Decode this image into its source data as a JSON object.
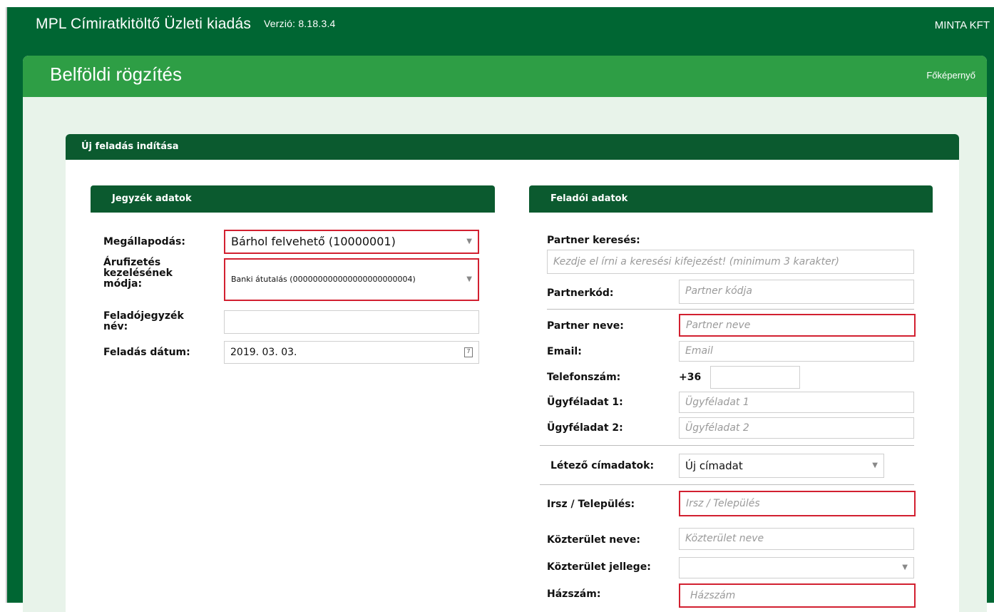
{
  "app": {
    "title": "MPL Címiratkitöltő Üzleti kiadás",
    "version": "Verzió: 8.18.3.4",
    "company": "MINTA KFT"
  },
  "page": {
    "title": "Belföldi rögzítés",
    "home_link": "Főképernyő"
  },
  "card": {
    "title": "Új feladás indítása"
  },
  "left": {
    "section_title": "Jegyzék adatok",
    "agreement_label": "Megállapodás:",
    "agreement_value": "Bárhol felvehető (10000001)",
    "payment_label_1": "Árufizetés",
    "payment_label_2": "kezelésének",
    "payment_label_3": "módja:",
    "payment_value": "Banki átutalás (000000000000000000000004)",
    "sender_list_label_1": "Feladójegyzék",
    "sender_list_label_2": "név:",
    "sender_list_value": "",
    "date_label": "Feladás dátum:",
    "date_value": "2019. 03. 03."
  },
  "right": {
    "section_title": "Feladói adatok",
    "search_label": "Partner keresés:",
    "search_placeholder": "Kezdje el írni a keresési kifejezést! (minimum 3 karakter)",
    "code_label": "Partnerkód:",
    "code_placeholder": "Partner kódja",
    "name_label": "Partner neve:",
    "name_placeholder": "Partner neve",
    "email_label": "Email:",
    "email_placeholder": "Email",
    "phone_label": "Telefonszám:",
    "phone_prefix": "+36",
    "cust1_label": "Ügyféladat 1:",
    "cust1_placeholder": "Ügyféladat 1",
    "cust2_label": "Ügyféladat 2:",
    "cust2_placeholder": "Ügyféladat 2",
    "addr_label": "Létező címadatok:",
    "addr_value": "Új címadat",
    "zip_label": "Irsz / Település:",
    "zip_placeholder": "Irsz / Település",
    "street_label": "Közterület neve:",
    "street_placeholder": "Közterület neve",
    "street_type_label": "Közterület jellege:",
    "house_label": "Házszám:",
    "house_placeholder": "Házszám"
  },
  "icons": {
    "dropdown": "chevron-down-icon",
    "calendar": "calendar-icon"
  }
}
